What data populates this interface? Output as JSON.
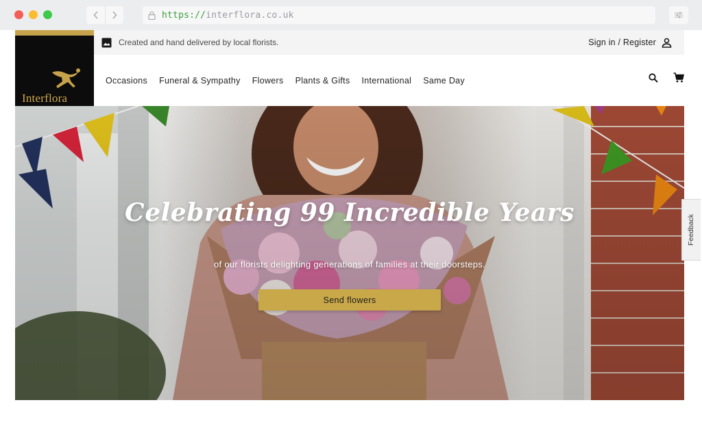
{
  "browser": {
    "url_scheme": "https://",
    "url_host": "interflora.co.uk"
  },
  "utility_bar": {
    "tagline": "Created and hand delivered by local florists.",
    "signin_label": "Sign in / Register"
  },
  "logo": {
    "text": "Interflora"
  },
  "nav": {
    "items": [
      {
        "label": "Occasions"
      },
      {
        "label": "Funeral & Sympathy"
      },
      {
        "label": "Flowers"
      },
      {
        "label": "Plants & Gifts"
      },
      {
        "label": "International"
      },
      {
        "label": "Same Day"
      }
    ]
  },
  "header_icons": [
    "search-icon",
    "cart-icon"
  ],
  "hero": {
    "title": "Celebrating 99 Incredible Years",
    "subtitle": "of our florists delighting generations of families at their doorsteps.",
    "cta_label": "Send flowers"
  },
  "feedback": {
    "label": "Feedback"
  },
  "colors": {
    "gold": "#c9a84a",
    "logo_bg": "#0c0c0c",
    "url_scheme": "#3b9c3a"
  }
}
